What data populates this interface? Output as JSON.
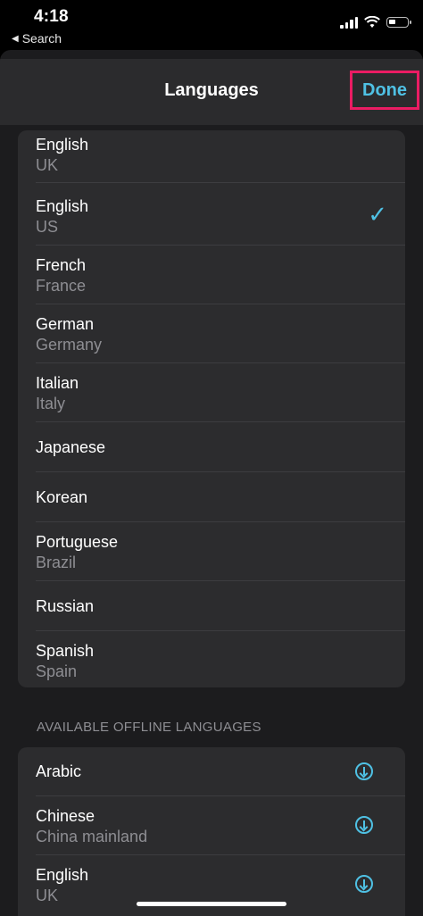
{
  "status_bar": {
    "time": "4:18",
    "back_label": "Search"
  },
  "nav": {
    "title": "Languages",
    "done_label": "Done"
  },
  "languages": [
    {
      "name": "English",
      "region": "UK",
      "selected": false
    },
    {
      "name": "English",
      "region": "US",
      "selected": true
    },
    {
      "name": "French",
      "region": "France",
      "selected": false
    },
    {
      "name": "German",
      "region": "Germany",
      "selected": false
    },
    {
      "name": "Italian",
      "region": "Italy",
      "selected": false
    },
    {
      "name": "Japanese",
      "region": "",
      "selected": false
    },
    {
      "name": "Korean",
      "region": "",
      "selected": false
    },
    {
      "name": "Portuguese",
      "region": "Brazil",
      "selected": false
    },
    {
      "name": "Russian",
      "region": "",
      "selected": false
    },
    {
      "name": "Spanish",
      "region": "Spain",
      "selected": false
    }
  ],
  "offline_section": {
    "header": "AVAILABLE OFFLINE LANGUAGES",
    "items": [
      {
        "name": "Arabic",
        "region": ""
      },
      {
        "name": "Chinese",
        "region": "China mainland"
      },
      {
        "name": "English",
        "region": "UK"
      }
    ]
  },
  "icons": {
    "selected": "checkmark-icon",
    "download": "download-circle-icon"
  },
  "colors": {
    "accent": "#4fc1e4",
    "highlight_border": "#ea1c63",
    "background": "#1c1c1e",
    "cell": "#2c2c2e"
  }
}
